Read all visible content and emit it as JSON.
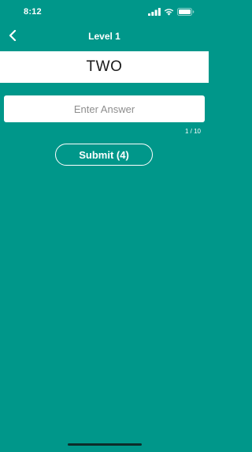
{
  "status_bar": {
    "time": "8:12",
    "icons": [
      "signal-icon",
      "wifi-icon",
      "battery-icon"
    ]
  },
  "nav": {
    "title": "Level 1",
    "back_icon": "chevron-left-icon"
  },
  "word": {
    "text": "TWO"
  },
  "answer": {
    "placeholder": "Enter Answer",
    "value": ""
  },
  "progress": {
    "counter": "1 / 10"
  },
  "submit": {
    "label": "Submit (4)"
  },
  "colors": {
    "background": "#00978a",
    "panel": "#ffffff",
    "text_light": "#ffffff",
    "text_dark": "#1a1a1a"
  }
}
